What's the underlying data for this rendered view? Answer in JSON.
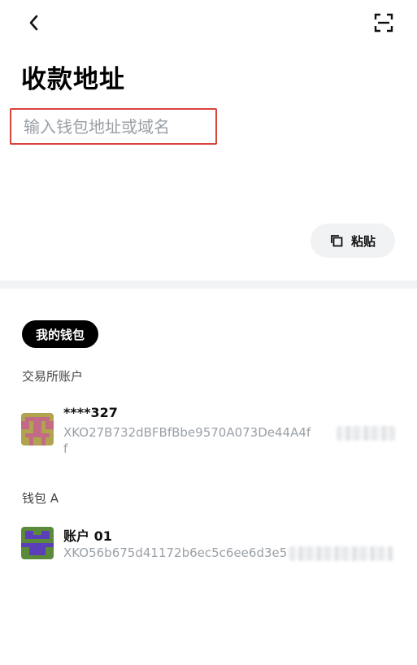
{
  "header": {
    "back_icon": "chevron-left-icon",
    "scan_icon": "scan-frame-icon"
  },
  "page": {
    "title": "收款地址"
  },
  "address_input": {
    "placeholder": "输入钱包地址或域名",
    "value": ""
  },
  "paste_button": {
    "icon": "copy-icon",
    "label": "粘贴"
  },
  "tabs": {
    "active_label": "我的钱包"
  },
  "sections": [
    {
      "label": "交易所账户",
      "items": [
        {
          "name": "****327",
          "address_line1": "XKO27B732dBFBfBbe9570A073De44A4f",
          "address_line2": "f",
          "avatar_colors": [
            "#b0a44e",
            "#c36b86"
          ]
        }
      ]
    },
    {
      "label": "钱包 A",
      "items": [
        {
          "name": "账户 01",
          "address_line1": "XKO56b675d41172b6ec5c6ee6d3e5",
          "avatar_colors": [
            "#5a8a3a",
            "#5b3fb8"
          ]
        }
      ]
    }
  ],
  "colors": {
    "highlight_border": "#d9443f",
    "pill_bg": "#000000",
    "placeholder": "#9aa0a6",
    "chip_bg": "#f1f2f3"
  }
}
